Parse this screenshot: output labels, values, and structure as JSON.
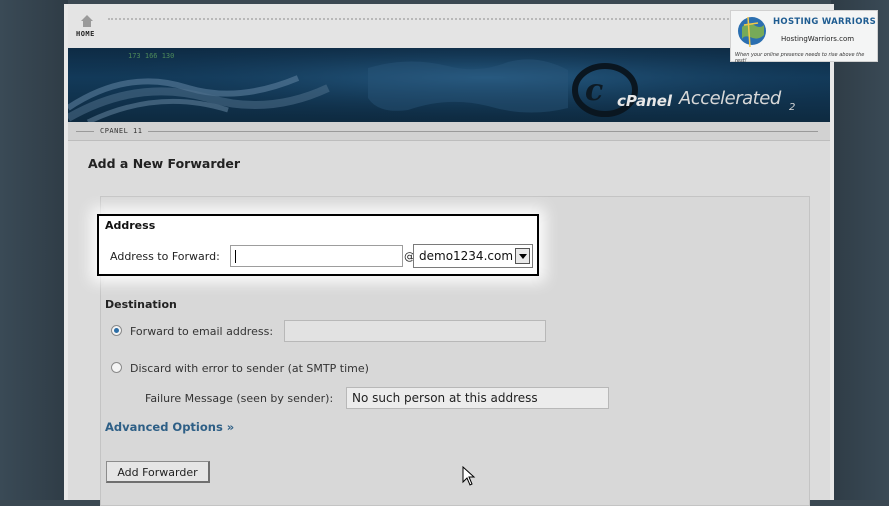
{
  "header": {
    "home_label": "HOME"
  },
  "banner": {
    "brand_c": "c",
    "brand_panel": "Panel",
    "brand_accel": "Accelerated",
    "brand_version": "2"
  },
  "breadcrumb": {
    "label": "CPANEL 11"
  },
  "page_title": "Add a New Forwarder",
  "address": {
    "section_title": "Address",
    "label": "Address to Forward:",
    "value": "",
    "at_symbol": "@",
    "domain_selected": "demo1234.com"
  },
  "destination": {
    "section_title": "Destination",
    "forward_label": "Forward to email address:",
    "forward_value": "",
    "discard_label": "Discard with error to sender (at SMTP time)",
    "failure_label": "Failure Message (seen by sender):",
    "failure_value": "No such person at this address",
    "selected_option": "forward"
  },
  "advanced_options": "Advanced Options »",
  "add_button_label": "Add Forwarder",
  "watermark": {
    "title": "HOSTING WARRIORS",
    "site": "HostingWarriors.com",
    "tagline": "When your online presence needs to rise above the rest!"
  },
  "colors": {
    "accent": "#2e5f86",
    "background": "#3b4852",
    "banner": "#123a5a"
  }
}
